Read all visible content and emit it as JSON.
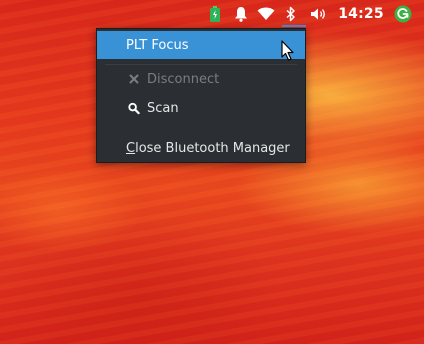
{
  "tray": {
    "clock": "14:25",
    "icons": [
      "battery-icon",
      "bell-icon",
      "wifi-icon",
      "bluetooth-icon",
      "volume-icon",
      "update-icon"
    ],
    "accent_color": "#4a90d9",
    "update_color": "#3cb043"
  },
  "menu": {
    "device_label": "PLT Focus",
    "disconnect_label": "Disconnect",
    "scan_label": "Scan",
    "close_label_mnemonic": "C",
    "close_label_rest": "lose Bluetooth Manager",
    "highlight_color": "#3a92d6",
    "background_color": "#2b2e33"
  }
}
